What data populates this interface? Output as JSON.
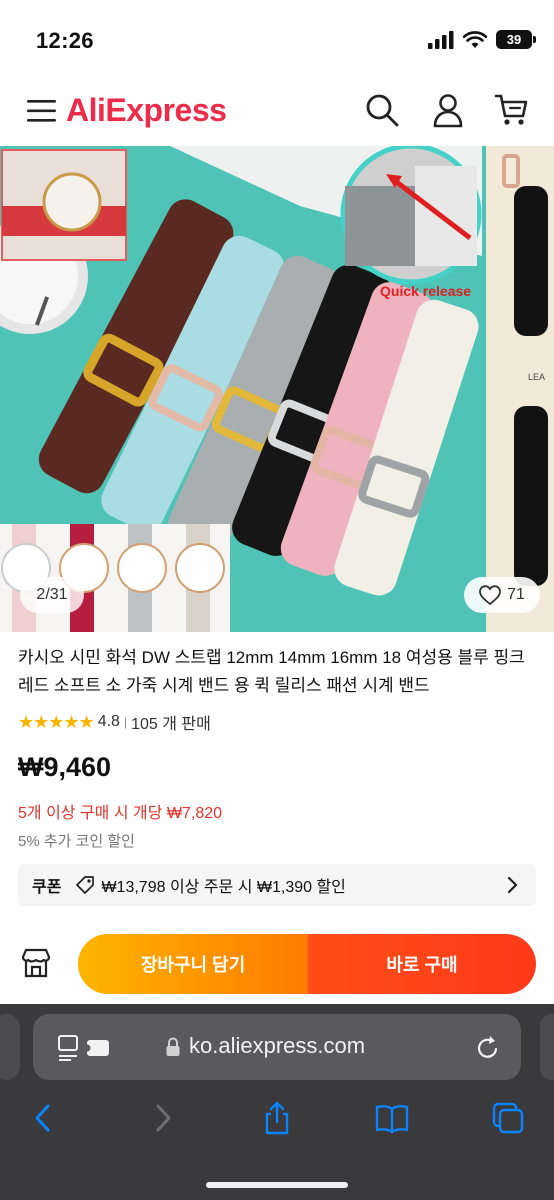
{
  "status_bar": {
    "time": "12:26",
    "battery": "39"
  },
  "header": {
    "logo": "AliExpress",
    "icons": [
      "menu-icon",
      "search-icon",
      "account-icon",
      "cart-icon"
    ]
  },
  "gallery": {
    "counter": "2/31",
    "likes": "71",
    "photo_caption": "Quick release",
    "side_photo_text": "LEA"
  },
  "product": {
    "title": "카시오 시민 화석 DW 스트랩 12mm 14mm 16mm 18 여성용 블루 핑크 레드 소프트 소 가죽 시계 밴드 용 퀵 릴리스 패션 시계 밴드",
    "rating_value": "4.8",
    "rating_separator": "|",
    "sold": "105 개 판매",
    "price": "₩9,460",
    "bulk_discount": "5개 이상 구매 시 개당 ₩7,820",
    "coin_discount": "5% 추가 코인 할인",
    "coupon_label": "쿠폰",
    "coupon_text": "₩13,798 이상 주문 시 ₩1,390 할인"
  },
  "actions": {
    "add_to_cart": "장바구니 담기",
    "buy_now": "바로 구매"
  },
  "browser": {
    "url": "ko.aliexpress.com"
  },
  "colors": {
    "brand_red": "#ee2b4a",
    "brand_orange": "#ff7a00",
    "price_red": "#e0352b",
    "cart_button": "#ffb400",
    "buy_button": "#ff4e15",
    "safari_chrome": "#3a3a3c",
    "safari_blue": "#0a84ff"
  }
}
